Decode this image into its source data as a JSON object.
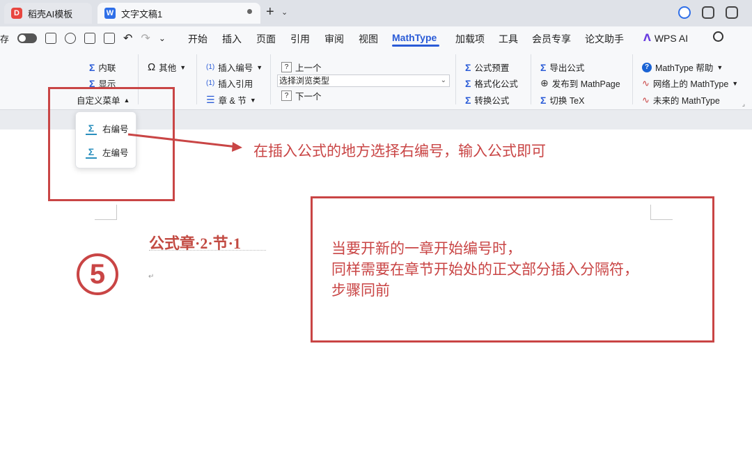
{
  "tabs": {
    "tab1_label": "稻壳AI模板",
    "tab2_label": "文字文稿1"
  },
  "menubar": {
    "save_fragment": "存",
    "items": [
      "开始",
      "插入",
      "页面",
      "引用",
      "审阅",
      "视图",
      "MathType",
      "加载项",
      "工具",
      "会员专享",
      "论文助手",
      "WPS AI"
    ]
  },
  "ribbon": {
    "inline": "内联",
    "display": "显示",
    "custom_menu": "自定义菜单",
    "other": "其他",
    "insert_number": "插入编号",
    "insert_ref": "插入引用",
    "chapter_section": "章 & 节",
    "prev": "上一个",
    "browse_type": "选择浏览类型",
    "next": "下一个",
    "formula_preset": "公式预置",
    "format_formula": "格式化公式",
    "convert_formula": "转换公式",
    "export_formula": "导出公式",
    "publish": "发布到 MathPage",
    "switch_tex": "切换 TeX",
    "help": "MathType 帮助",
    "online": "网络上的 MathType",
    "future": "未来的 MathType"
  },
  "dropdown": {
    "right_number": "右编号",
    "left_number": "左编号"
  },
  "annotations": {
    "arrow_text": "在插入公式的地方选择右编号，输入公式即可",
    "info_line1": "当要开新的一章开始编号时，",
    "info_line2": "同样需要在章节开始处的正文部分插入分隔符，",
    "info_line3": "步骤同前",
    "step_number": "5"
  },
  "document": {
    "heading": "公式章·2·节·1"
  },
  "colors": {
    "annotation_red": "#c94545",
    "accent_blue": "#2a5bd7"
  }
}
